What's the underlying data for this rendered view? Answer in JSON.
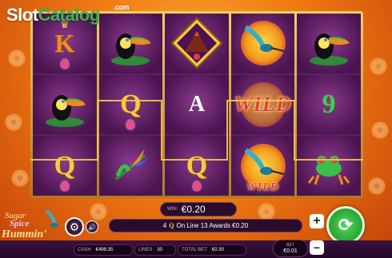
{
  "watermark": {
    "part1": "Slot",
    "part2": "Catalog",
    "suffix": ".com"
  },
  "reels": [
    [
      {
        "type": "letter",
        "text": "K"
      },
      {
        "type": "toucan"
      },
      {
        "type": "letter",
        "text": "Q"
      }
    ],
    [
      {
        "type": "toucan"
      },
      {
        "type": "letter",
        "text": "Q"
      },
      {
        "type": "flower"
      }
    ],
    [
      {
        "type": "volcano"
      },
      {
        "type": "letter",
        "text": "A"
      },
      {
        "type": "letter",
        "text": "Q"
      }
    ],
    [
      {
        "type": "hummingbird"
      },
      {
        "type": "wild",
        "text": "WILD"
      },
      {
        "type": "hummingbird-wild",
        "text": "WILD"
      }
    ],
    [
      {
        "type": "toucan"
      },
      {
        "type": "letter",
        "text": "9"
      },
      {
        "type": "frog"
      }
    ]
  ],
  "win": {
    "label": "WIN",
    "value": "€0.20"
  },
  "message": {
    "count": "4",
    "symbol": "Q",
    "text": "On Line 13 Awards €0.20"
  },
  "stats": {
    "cash": {
      "label": "CASH",
      "value": "€499.35"
    },
    "lines": {
      "label": "LINES",
      "value": "30"
    },
    "total_bet": {
      "label": "TOTAL BET",
      "value": "€0.30"
    }
  },
  "bet": {
    "label": "BET",
    "value": "€0.01"
  },
  "game_logo": {
    "line1": "Sugar",
    "line2": "Spice",
    "line3": "Hummin'"
  },
  "buttons": {
    "plus": "+",
    "minus": "−",
    "spin": "⟳",
    "settings": "⚙",
    "sound": "🔊"
  },
  "colors": {
    "gold": "#f6c94a",
    "purple": "#4b1450",
    "green": "#3db54a",
    "wild": "#e63c3c"
  }
}
